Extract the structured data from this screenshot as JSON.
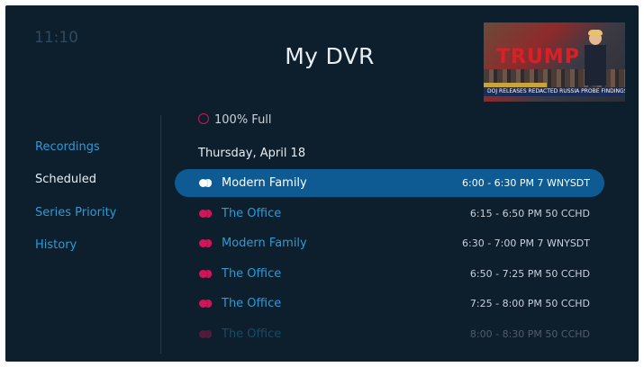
{
  "clock": "11:10",
  "title": "My DVR",
  "preview": {
    "sign_text": "TRUMP",
    "ticker_text": "DOJ RELEASES REDACTED RUSSIA PROBE FINDINGS"
  },
  "sidebar": {
    "items": [
      {
        "label": "Recordings"
      },
      {
        "label": "Scheduled"
      },
      {
        "label": "Series Priority"
      },
      {
        "label": "History"
      }
    ]
  },
  "capacity": "100% Full",
  "date_header": "Thursday, April 18",
  "colors": {
    "accent": "#2e9ad6",
    "selected_row": "#0e5b94",
    "record_icon": "#d4145a",
    "background": "#0d1e2c"
  },
  "listings": [
    {
      "title": "Modern Family",
      "time": "6:00 - 6:30 PM  7 WNYSDT"
    },
    {
      "title": "The Office",
      "time": "6:15 - 6:50 PM  50 CCHD"
    },
    {
      "title": "Modern Family",
      "time": "6:30 - 7:00 PM  7 WNYSDT"
    },
    {
      "title": "The Office",
      "time": "6:50 - 7:25 PM  50 CCHD"
    },
    {
      "title": "The Office",
      "time": "7:25 - 8:00 PM  50 CCHD"
    },
    {
      "title": "The Office",
      "time": "8:00 - 8:30 PM  50 CCHD"
    }
  ]
}
